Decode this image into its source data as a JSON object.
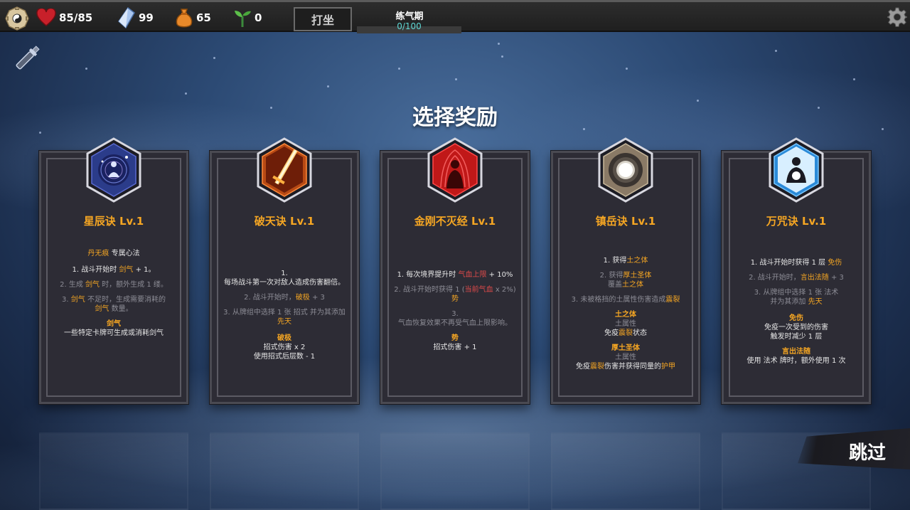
{
  "topbar": {
    "hp": "85/85",
    "spirit_stones": "99",
    "gourd": "65",
    "sprout": "0",
    "meditate_label": "打坐",
    "realm_name": "练气期",
    "realm_progress": "0/100",
    "realm_progress_fraction": 0
  },
  "title": "选择奖励",
  "skip_label": "跳过",
  "colors": {
    "gold": "#f5a623",
    "red": "#e04a4a",
    "teal": "#5ed8d4"
  },
  "cards": [
    {
      "name": "星辰诀 Lv.1",
      "icon": "meditation-nebula-icon",
      "lines": [
        [
          {
            "t": "丹无痕",
            "c": "gold"
          },
          {
            "t": " 专属心法"
          }
        ],
        [
          {
            "t": "1. 战斗开始时 "
          },
          {
            "t": "剑气",
            "c": "gold"
          },
          {
            "t": " + 1。"
          }
        ],
        [
          {
            "t": "2. 生成 ",
            "c": "dim"
          },
          {
            "t": "剑气",
            "c": "gold"
          },
          {
            "t": " 时，额外生成 1 缕。",
            "c": "dim"
          }
        ],
        [
          {
            "t": "3. ",
            "c": "dim"
          },
          {
            "t": "剑气",
            "c": "gold"
          },
          {
            "t": " 不足时，生成需要消耗的",
            "c": "dim"
          }
        ],
        [
          {
            "t": "剑气",
            "c": "gold"
          },
          {
            "t": " 数量。",
            "c": "dim"
          }
        ],
        [
          {
            "t": "剑气",
            "c": "gold",
            "b": true
          }
        ],
        [
          {
            "t": "一些特定卡牌可生成或消耗剑气"
          }
        ]
      ]
    },
    {
      "name": "破天诀 Lv.1",
      "icon": "flaming-sword-icon",
      "lines": [
        [
          {
            "t": "1."
          }
        ],
        [
          {
            "t": "每场战斗第一次对敌人造成伤害翻倍。"
          }
        ],
        [
          {
            "t": "2. 战斗开始时，",
            "c": "dim"
          },
          {
            "t": "破极",
            "c": "gold"
          },
          {
            "t": " + 3",
            "c": "dim"
          }
        ],
        [
          {
            "t": "3. 从牌组中选择 1 张 招式 并为其添加",
            "c": "dim"
          }
        ],
        [
          {
            "t": "先天",
            "c": "gold"
          }
        ],
        [
          {
            "t": "破极",
            "c": "gold",
            "b": true
          }
        ],
        [
          {
            "t": "招式伤害 x 2"
          }
        ],
        [
          {
            "t": "使用招式后层数 - 1"
          }
        ]
      ]
    },
    {
      "name": "金刚不灭经 Lv.1",
      "icon": "red-aura-figure-icon",
      "lines": [
        [
          {
            "t": "1. 每次境界提升时 "
          },
          {
            "t": "气血上限",
            "c": "red"
          },
          {
            "t": " + 10%"
          }
        ],
        [
          {
            "t": "2. 战斗开始时获得 1 (",
            "c": "dim"
          },
          {
            "t": "当前气血",
            "c": "red"
          },
          {
            "t": " x 2%)",
            "c": "dim"
          }
        ],
        [
          {
            "t": "势",
            "c": "gold"
          }
        ],
        [
          {
            "t": "3.",
            "c": "dim"
          }
        ],
        [
          {
            "t": "气血恢复效果不再受气血上限影响。",
            "c": "dim"
          }
        ],
        [
          {
            "t": "势",
            "c": "gold",
            "b": true
          }
        ],
        [
          {
            "t": "招式伤害 + 1"
          }
        ]
      ]
    },
    {
      "name": "镇岳诀 Lv.1",
      "icon": "light-orb-icon",
      "lines": [
        [
          {
            "t": "1. 获得"
          },
          {
            "t": "土之体",
            "c": "gold"
          }
        ],
        [
          {
            "t": "2. 获得",
            "c": "dim"
          },
          {
            "t": "厚土圣体",
            "c": "gold"
          }
        ],
        [
          {
            "t": "覆盖",
            "c": "dim"
          },
          {
            "t": "土之体",
            "c": "gold"
          }
        ],
        [
          {
            "t": "3. 未被格挡的土属性伤害造成",
            "c": "dim"
          },
          {
            "t": "震裂",
            "c": "gold"
          }
        ],
        [
          {
            "t": "土之体",
            "c": "gold",
            "b": true
          }
        ],
        [
          {
            "t": "土属性",
            "c": "dim"
          }
        ],
        [
          {
            "t": "免疫"
          },
          {
            "t": "震裂",
            "c": "gold"
          },
          {
            "t": "状态"
          }
        ],
        [
          {
            "t": "厚土圣体",
            "c": "gold",
            "b": true
          }
        ],
        [
          {
            "t": "土属性",
            "c": "dim"
          }
        ],
        [
          {
            "t": "免疫"
          },
          {
            "t": "震裂",
            "c": "gold"
          },
          {
            "t": "伤害并获得同量的"
          },
          {
            "t": "护甲",
            "c": "gold"
          }
        ]
      ]
    },
    {
      "name": "万咒诀 Lv.1",
      "icon": "glowing-meditator-icon",
      "lines": [
        [
          {
            "t": "1. 战斗开始时获得 1 层 "
          },
          {
            "t": "免伤",
            "c": "gold"
          }
        ],
        [
          {
            "t": "2. 战斗开始时，",
            "c": "dim"
          },
          {
            "t": "言出法随",
            "c": "gold"
          },
          {
            "t": " + 3",
            "c": "dim"
          }
        ],
        [
          {
            "t": "3. 从牌组中选择 1 张 法术",
            "c": "dim"
          }
        ],
        [
          {
            "t": "并为其添加 ",
            "c": "dim"
          },
          {
            "t": "先天",
            "c": "gold"
          }
        ],
        [
          {
            "t": "免伤",
            "c": "gold",
            "b": true
          }
        ],
        [
          {
            "t": "免疫一次受到的伤害"
          }
        ],
        [
          {
            "t": "触发时减少 1 层"
          }
        ],
        [
          {
            "t": "言出法随",
            "c": "gold",
            "b": true
          }
        ],
        [
          {
            "t": "使用 法术 牌时，额外使用 1 次"
          }
        ]
      ]
    }
  ]
}
